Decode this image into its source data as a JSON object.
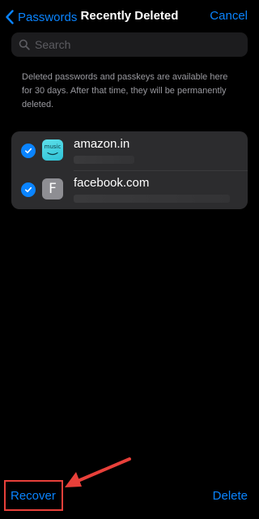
{
  "nav": {
    "back_label": "Passwords",
    "title": "Recently Deleted",
    "cancel_label": "Cancel"
  },
  "search": {
    "placeholder": "Search"
  },
  "info_text": "Deleted passwords and passkeys are available here for 30 days. After that time, they will be permanently deleted.",
  "items": [
    {
      "site": "amazon.in",
      "icon_text": "music",
      "icon": "amazon-music-icon",
      "selected": true
    },
    {
      "site": "facebook.com",
      "icon_text": "F",
      "icon": "letter-f-icon",
      "selected": true
    }
  ],
  "toolbar": {
    "recover_label": "Recover",
    "delete_label": "Delete"
  },
  "colors": {
    "accent": "#0a84ff",
    "annotation": "#e8403a"
  }
}
